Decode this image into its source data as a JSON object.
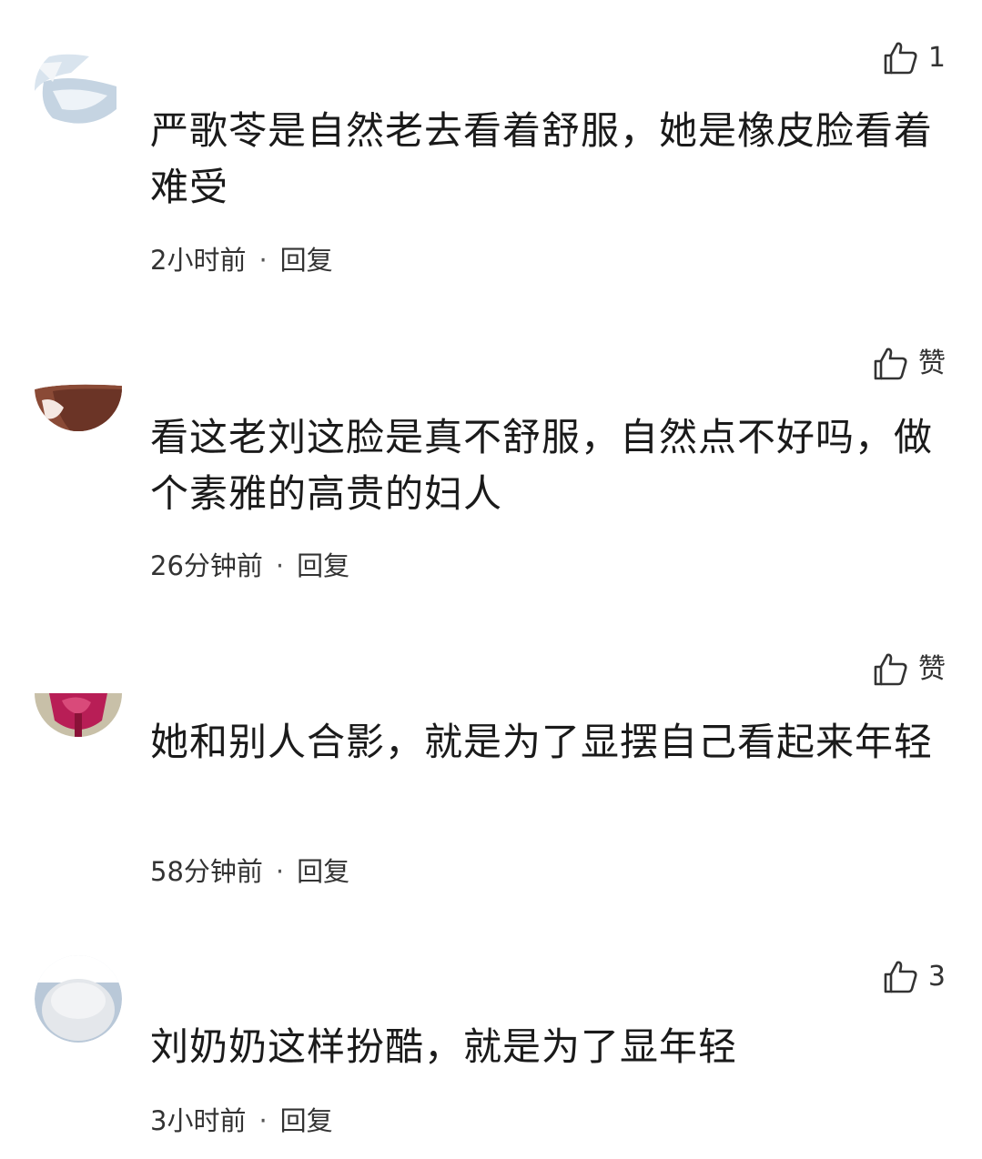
{
  "comments": [
    {
      "text": "严歌苓是自然老去看着舒服，她是橡皮脸看着难受",
      "time": "2小时前",
      "reply_label": "回复",
      "likes": "1",
      "dot": "·"
    },
    {
      "text": "看这老刘这脸是真不舒服，自然点不好吗，做个素雅的高贵的妇人",
      "time": "26分钟前",
      "reply_label": "回复",
      "likes": "赞",
      "dot": "·"
    },
    {
      "text": "她和别人合影，就是为了显摆自己看起来年轻",
      "time": "58分钟前",
      "reply_label": "回复",
      "likes": "赞",
      "dot": "·"
    },
    {
      "text": "刘奶奶这样扮酷，就是为了显年轻",
      "time": "3小时前",
      "reply_label": "回复",
      "likes": "3",
      "dot": "·"
    }
  ],
  "icons": {
    "like": "thumbs-up-icon"
  },
  "colors": {
    "text": "#1a1a1a",
    "meta": "#333333",
    "background": "#ffffff"
  }
}
